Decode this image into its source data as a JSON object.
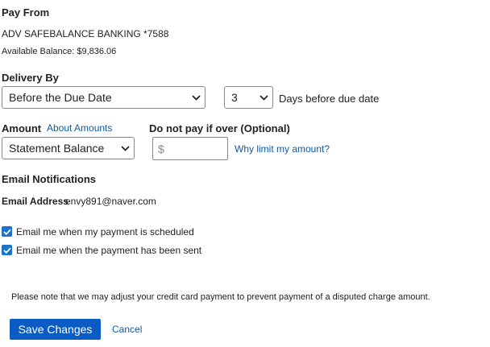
{
  "pay_from": {
    "heading": "Pay From",
    "account": "ADV SAFEBALANCE BANKING *7588",
    "available_balance": "Available Balance: $9,836.06"
  },
  "delivery": {
    "heading": "Delivery By",
    "timing_selected": "Before the Due Date",
    "days_selected": "3",
    "days_suffix": "Days before due date"
  },
  "amount": {
    "heading": "Amount",
    "about_link": "About Amounts",
    "selected": "Statement Balance",
    "limit_heading": "Do not pay if over (Optional)",
    "currency_prefix": "$",
    "limit_value": "",
    "why_link": "Why limit my amount?"
  },
  "email": {
    "heading": "Email Notifications",
    "address_label": "Email Address",
    "address_value": "envy891@naver.com",
    "opt_scheduled": "Email me when my payment is scheduled",
    "opt_sent": "Email me when the payment has been sent"
  },
  "note": "Please note that we may adjust your credit card payment to prevent payment of a disputed charge amount.",
  "actions": {
    "save": "Save Changes",
    "cancel": "Cancel"
  },
  "colors": {
    "primary": "#0a5bc4",
    "link": "#0a5ba8",
    "checkbox": "#1a73c8"
  }
}
